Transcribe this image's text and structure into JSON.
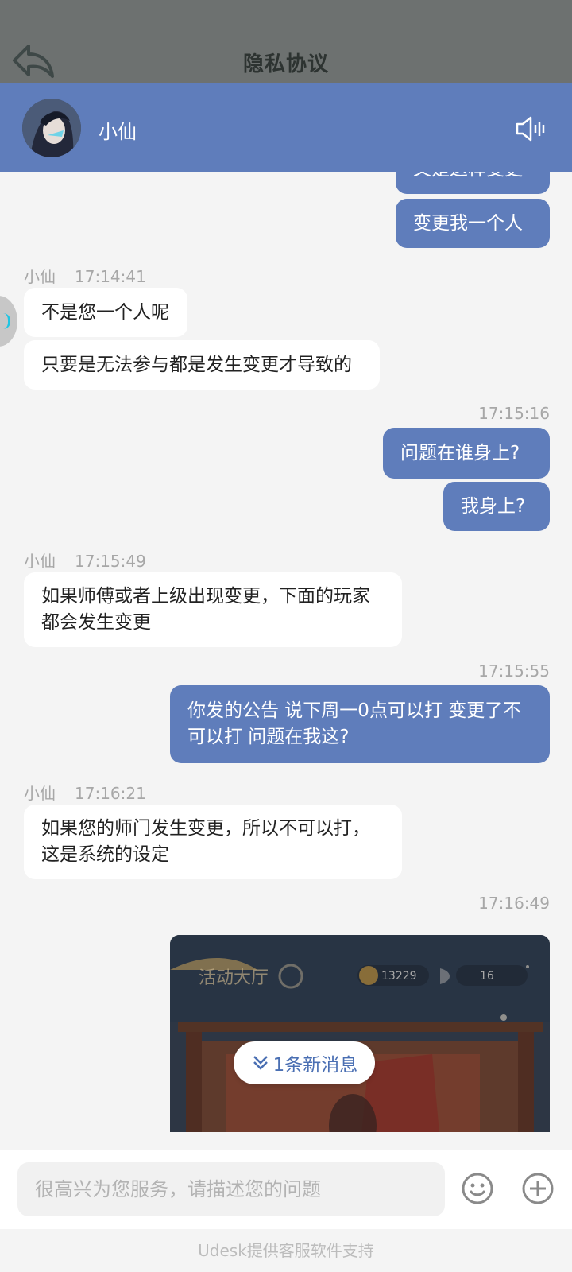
{
  "topbar": {
    "title": "隐私协议",
    "back_icon": "back-arrow-icon"
  },
  "header": {
    "agent_name": "小仙",
    "avatar_icon": "agent-avatar",
    "sound_icon": "speaker-icon",
    "bg_color": "#5f7dbb"
  },
  "messages": {
    "m0": {
      "text": "又是这样变更"
    },
    "m1": {
      "text": "变更我一个人"
    },
    "g1": {
      "name": "小仙",
      "time": "17:14:41"
    },
    "m2": {
      "text": "不是您一个人呢"
    },
    "m3": {
      "text": "只要是无法参与都是发生变更才导致的"
    },
    "t1": {
      "time": "17:15:16"
    },
    "m4": {
      "text": "问题在谁身上?"
    },
    "m5": {
      "text": "我身上?"
    },
    "g2": {
      "name": "小仙",
      "time": "17:15:49"
    },
    "m6": {
      "text": "如果师傅或者上级出现变更，下面的玩家都会发生变更"
    },
    "t2": {
      "time": "17:15:55"
    },
    "m7": {
      "text": "你发的公告 说下周一0点可以打 变更了不可以打 问题在我这?"
    },
    "g3": {
      "name": "小仙",
      "time": "17:16:21"
    },
    "m8": {
      "text": "如果您的师门发生变更，所以不可以打，这是系统的设定"
    },
    "t3": {
      "time": "17:16:49"
    }
  },
  "image_message": {
    "label": "活动大厅",
    "coins": "13229",
    "tickets": "16"
  },
  "new_message_pill": {
    "text": "1条新消息",
    "icon": "double-chevron-down-icon"
  },
  "input": {
    "placeholder": "很高兴为您服务，请描述您的问题",
    "value": "",
    "emoji_icon": "emoji-icon",
    "plus_icon": "plus-circle-icon"
  },
  "footer": {
    "text": "Udesk提供客服软件支持"
  }
}
